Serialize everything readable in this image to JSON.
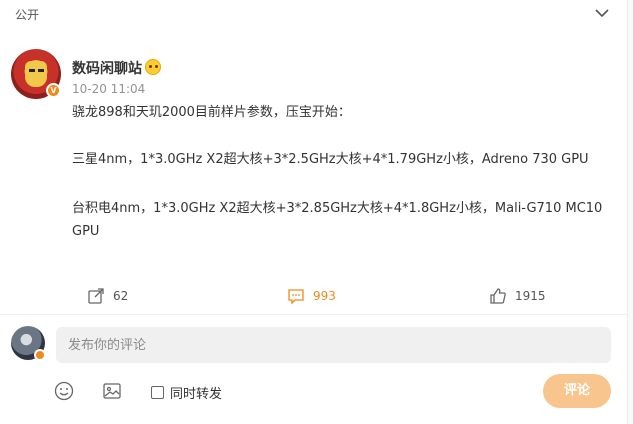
{
  "header": {
    "visibility": "公开",
    "collapse_icon": "chevron-down-icon"
  },
  "post": {
    "author": "数码闲聊站",
    "verified_badge": "V",
    "time": "10-20 11:04",
    "lines": [
      "骁龙898和天玑2000目前样片参数，压宝开始：",
      "三星4nm，1*3.0GHz X2超大核+3*2.5GHz大核+4*1.79GHz小核，Adreno 730 GPU",
      "台积电4nm，1*3.0GHz X2超大核+3*2.85GHz大核+4*1.8GHz小核，Mali-G710 MC10 GPU"
    ]
  },
  "actions": {
    "repost_count": "62",
    "comment_count": "993",
    "like_count": "1915",
    "accent_color": "#f08a1d"
  },
  "composer": {
    "placeholder": "发布你的评论",
    "repost_label": "同时转发",
    "submit_label": "评论"
  }
}
